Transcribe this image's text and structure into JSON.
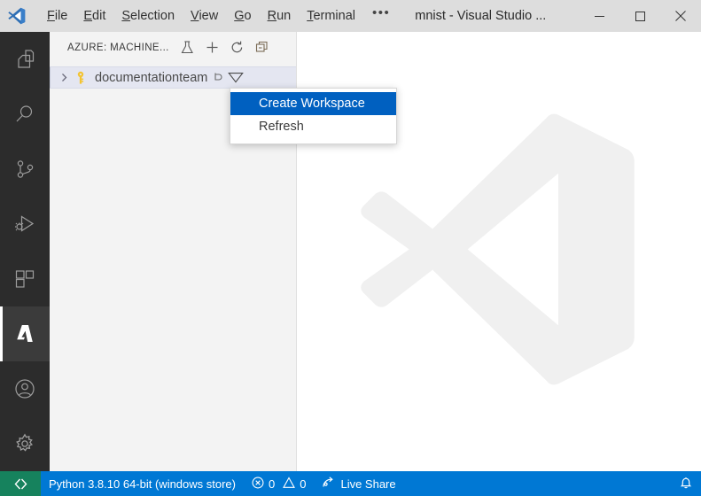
{
  "window": {
    "title": "mnist - Visual Studio ...",
    "logo_icon": "vscode-logo-icon",
    "menus": [
      {
        "label": "File",
        "accel": "F"
      },
      {
        "label": "Edit",
        "accel": "E"
      },
      {
        "label": "Selection",
        "accel": "S"
      },
      {
        "label": "View",
        "accel": "V"
      },
      {
        "label": "Go",
        "accel": "G"
      },
      {
        "label": "Run",
        "accel": "R"
      },
      {
        "label": "Terminal",
        "accel": "T"
      }
    ],
    "menu_overflow": "•••",
    "controls": {
      "minimize": "minimize-icon",
      "maximize": "maximize-icon",
      "close": "close-icon"
    }
  },
  "activitybar": {
    "items": [
      {
        "name": "explorer",
        "icon": "files-icon",
        "active": false
      },
      {
        "name": "search",
        "icon": "search-icon",
        "active": false
      },
      {
        "name": "source-control",
        "icon": "source-control-icon",
        "active": false
      },
      {
        "name": "run-and-debug",
        "icon": "run-debug-icon",
        "active": false
      },
      {
        "name": "extensions",
        "icon": "extensions-icon",
        "active": false
      },
      {
        "name": "azure",
        "icon": "azure-icon",
        "active": true
      }
    ],
    "bottom_items": [
      {
        "name": "accounts",
        "icon": "account-icon"
      },
      {
        "name": "manage",
        "icon": "gear-icon"
      }
    ]
  },
  "sidebar": {
    "title": "AZURE: MACHINE...",
    "actions": [
      {
        "name": "experiment",
        "icon": "flask-icon"
      },
      {
        "name": "add",
        "icon": "plus-icon"
      },
      {
        "name": "refresh",
        "icon": "refresh-icon"
      },
      {
        "name": "split",
        "icon": "split-editor-icon"
      }
    ],
    "tree": [
      {
        "label": "documentationteam",
        "icon": "key-icon",
        "twisty": "chevron-right-icon",
        "expanded": false,
        "selected": true,
        "row_actions": [
          {
            "name": "row-action",
            "icon": "more-icon"
          },
          {
            "name": "filter",
            "icon": "filter-icon"
          }
        ]
      }
    ]
  },
  "editor": {
    "watermark_icon": "vscode-watermark-logo",
    "watermark_color": "#f0f0f0"
  },
  "context_menu": {
    "items": [
      {
        "label": "Create Workspace",
        "selected": true
      },
      {
        "label": "Refresh",
        "selected": false
      }
    ]
  },
  "statusbar": {
    "remote_icon": "remote-window-icon",
    "python_version": "Python 3.8.10 64-bit (windows store)",
    "errors_icon": "error-icon",
    "errors_count": "0",
    "warnings_icon": "warning-icon",
    "warnings_count": "0",
    "live_share_icon": "live-share-icon",
    "live_share_label": "Live Share",
    "notifications_icon": "bell-icon"
  },
  "colors": {
    "titlebar_bg": "#dddddd",
    "activitybar_bg": "#2c2c2c",
    "sidebar_bg": "#f3f3f3",
    "editor_bg": "#ffffff",
    "statusbar_bg": "#0078d4",
    "remote_bg": "#16825d",
    "menu_selected_bg": "#0060c0",
    "tree_selected_bg": "#e4e6f1",
    "key_icon_color": "#f4c430"
  }
}
